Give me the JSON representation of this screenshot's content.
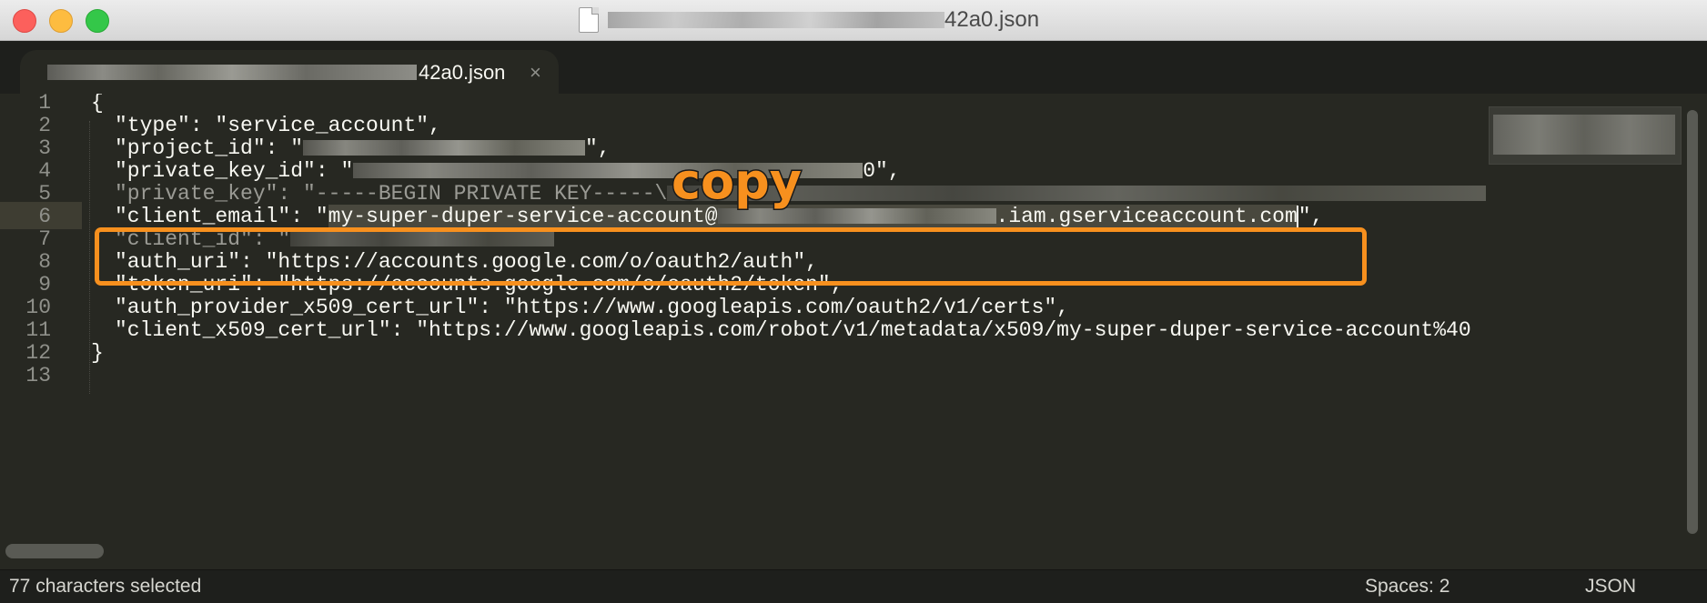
{
  "window": {
    "title_visible": "42a0.json"
  },
  "tab": {
    "label_visible": "42a0.json",
    "close_glyph": "×"
  },
  "editor": {
    "line_numbers": [
      "1",
      "2",
      "3",
      "4",
      "5",
      "6",
      "7",
      "8",
      "9",
      "10",
      "11",
      "12",
      "13"
    ],
    "lines": {
      "l1": "{",
      "l2": "\"type\": \"service_account\",",
      "l3_prefix": "\"project_id\": \"",
      "l3_suffix": "\",",
      "l4_prefix": "\"private_key_id\": \"",
      "l4_suffix": "0\",",
      "l5_partial": "\"private_key\": \"-----BEGIN PRIVATE KEY-----\\",
      "l6_key": "\"client_email\": \"",
      "l6_email_start": "my-super-duper-service-account@",
      "l6_email_end": ".iam.gserviceaccount.com",
      "l6_suffix": "\",",
      "l7_prefix": "\"client_id\": \"",
      "l8": "\"auth_uri\": \"https://accounts.google.com/o/oauth2/auth\",",
      "l9": "\"token_uri\": \"https://accounts.google.com/o/oauth2/token\",",
      "l10": "\"auth_provider_x509_cert_url\": \"https://www.googleapis.com/oauth2/v1/certs\",",
      "l11": "\"client_x509_cert_url\": \"https://www.googleapis.com/robot/v1/metadata/x509/my-super-duper-service-account%40",
      "l12": "}"
    }
  },
  "annotation": {
    "label": "copy",
    "color": "#f7901e"
  },
  "statusbar": {
    "selection": "77 characters selected",
    "indentation": "Spaces: 2",
    "syntax": "JSON"
  },
  "colors": {
    "editor_bg": "#272822",
    "text": "#f8f8f2",
    "line_number": "#8f908a",
    "selection": "#49483e"
  }
}
